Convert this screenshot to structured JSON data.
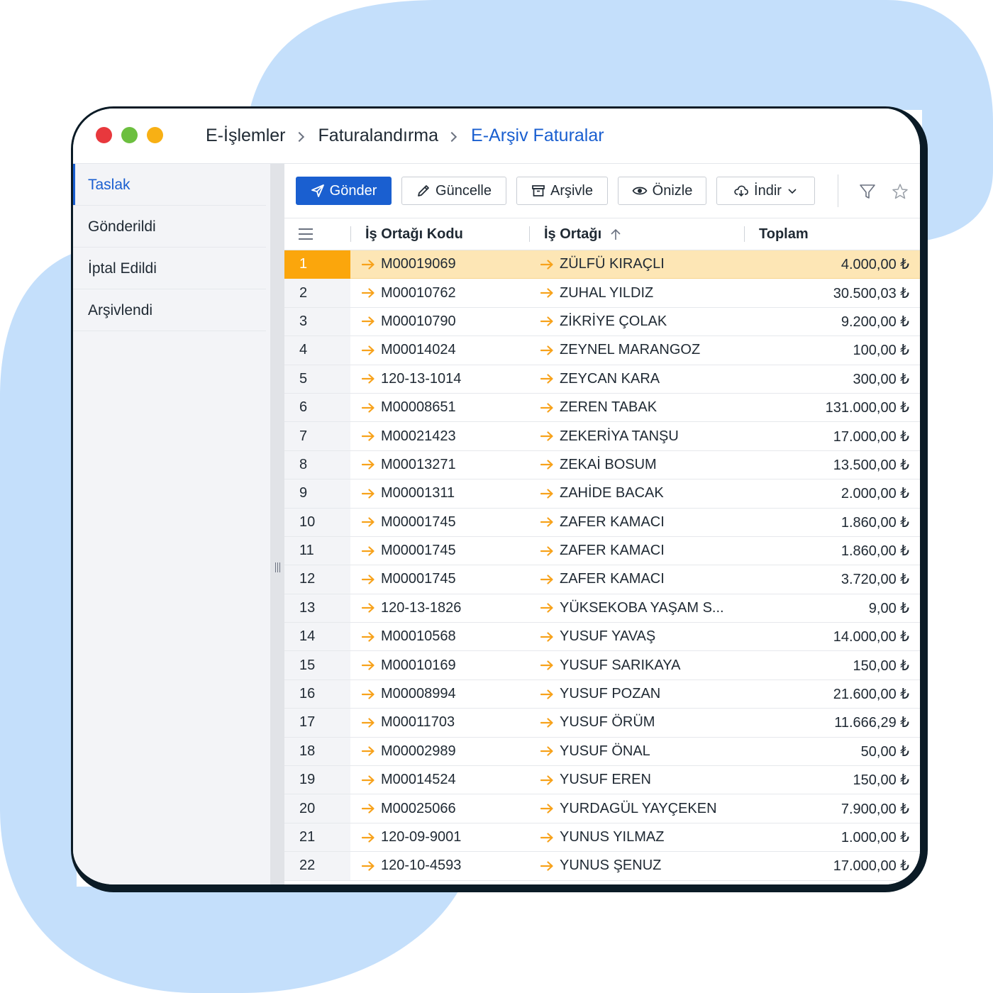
{
  "breadcrumb": [
    "E-İşlemler",
    "Faturalandırma",
    "E-Arşiv Faturalar"
  ],
  "sidebar": {
    "items": [
      {
        "label": "Taslak",
        "active": true
      },
      {
        "label": "Gönderildi",
        "active": false
      },
      {
        "label": "İptal Edildi",
        "active": false
      },
      {
        "label": "Arşivlendi",
        "active": false
      }
    ]
  },
  "toolbar": {
    "send_label": "Gönder",
    "update_label": "Güncelle",
    "archive_label": "Arşivle",
    "preview_label": "Önizle",
    "download_label": "İndir"
  },
  "colors": {
    "accent": "#1a5fd0",
    "selected_number": "#fba60c",
    "selected_row": "#fde6b5",
    "link_arrow": "#f7a21b",
    "backdrop": "#c4dffb"
  },
  "icons": {
    "send": "paper-plane-icon",
    "update": "pencil-icon",
    "archive": "archive-box-icon",
    "preview": "eye-icon",
    "download": "cloud-download-icon",
    "filter": "filter-icon",
    "favorite": "star-icon",
    "columns": "menu-icon",
    "sort": "arrow-up-icon"
  },
  "table": {
    "columns": {
      "code": "İş Ortağı Kodu",
      "partner": "İş Ortağı",
      "total": "Toplam"
    },
    "sort": {
      "column": "partner",
      "direction": "asc"
    },
    "selected_row": 1,
    "rows": [
      {
        "n": "1",
        "code": "M00019069",
        "partner": "ZÜLFÜ KIRAÇLI",
        "total": "4.000,00 ₺"
      },
      {
        "n": "2",
        "code": "M00010762",
        "partner": "ZUHAL YILDIZ",
        "total": "30.500,03 ₺"
      },
      {
        "n": "3",
        "code": "M00010790",
        "partner": "ZİKRİYE ÇOLAK",
        "total": "9.200,00 ₺"
      },
      {
        "n": "4",
        "code": "M00014024",
        "partner": "ZEYNEL MARANGOZ",
        "total": "100,00 ₺"
      },
      {
        "n": "5",
        "code": "120-13-1014",
        "partner": "ZEYCAN KARA",
        "total": "300,00 ₺"
      },
      {
        "n": "6",
        "code": "M00008651",
        "partner": "ZEREN TABAK",
        "total": "131.000,00 ₺"
      },
      {
        "n": "7",
        "code": "M00021423",
        "partner": "ZEKERİYA TANŞU",
        "total": "17.000,00 ₺"
      },
      {
        "n": "8",
        "code": "M00013271",
        "partner": "ZEKAİ BOSUM",
        "total": "13.500,00 ₺"
      },
      {
        "n": "9",
        "code": "M00001311",
        "partner": "ZAHİDE BACAK",
        "total": "2.000,00 ₺"
      },
      {
        "n": "10",
        "code": "M00001745",
        "partner": "ZAFER KAMACI",
        "total": "1.860,00 ₺"
      },
      {
        "n": "11",
        "code": "M00001745",
        "partner": "ZAFER KAMACI",
        "total": "1.860,00 ₺"
      },
      {
        "n": "12",
        "code": "M00001745",
        "partner": "ZAFER KAMACI",
        "total": "3.720,00 ₺"
      },
      {
        "n": "13",
        "code": "120-13-1826",
        "partner": "YÜKSEKOBA YAŞAM S...",
        "total": "9,00 ₺"
      },
      {
        "n": "14",
        "code": "M00010568",
        "partner": "YUSUF YAVAŞ",
        "total": "14.000,00 ₺"
      },
      {
        "n": "15",
        "code": "M00010169",
        "partner": "YUSUF SARIKAYA",
        "total": "150,00 ₺"
      },
      {
        "n": "16",
        "code": "M00008994",
        "partner": "YUSUF POZAN",
        "total": "21.600,00 ₺"
      },
      {
        "n": "17",
        "code": "M00011703",
        "partner": "YUSUF ÖRÜM",
        "total": "11.666,29 ₺"
      },
      {
        "n": "18",
        "code": "M00002989",
        "partner": "YUSUF ÖNAL",
        "total": "50,00 ₺"
      },
      {
        "n": "19",
        "code": "M00014524",
        "partner": "YUSUF EREN",
        "total": "150,00 ₺"
      },
      {
        "n": "20",
        "code": "M00025066",
        "partner": "YURDAGÜL YAYÇEKEN",
        "total": "7.900,00 ₺"
      },
      {
        "n": "21",
        "code": "120-09-9001",
        "partner": "YUNUS YILMAZ",
        "total": "1.000,00 ₺"
      },
      {
        "n": "22",
        "code": "120-10-4593",
        "partner": "YUNUS ŞENUZ",
        "total": "17.000,00 ₺"
      }
    ]
  }
}
